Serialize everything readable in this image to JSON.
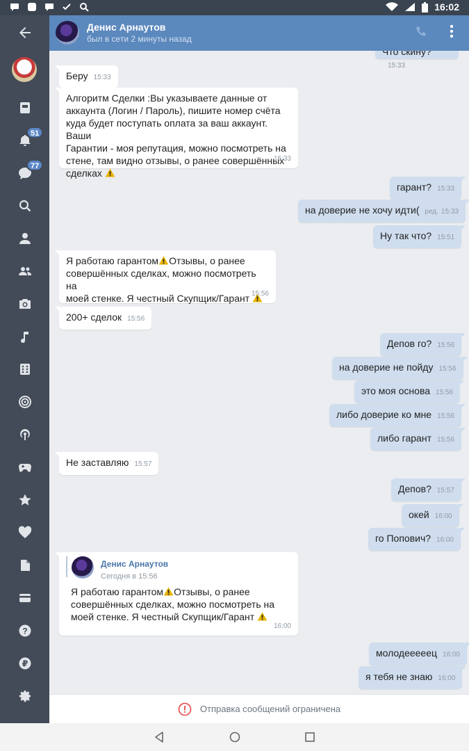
{
  "status_bar": {
    "time": "16:02"
  },
  "header": {
    "contact_name": "Денис Арнаутов",
    "contact_status": "был в сети 2 минуты назад"
  },
  "rail": {
    "notifications_badge": "51",
    "messages_badge": "77"
  },
  "messages": [
    {
      "dir": "out",
      "text": "Что скину?",
      "time": "15:33"
    },
    {
      "dir": "in",
      "text": "Беру",
      "time": "15:33"
    },
    {
      "dir": "in",
      "lines": [
        "Алгоритм Сделки :Вы указываете данные от",
        "аккаунта (Логин / Пароль), пишите номер счёта",
        "куда будет поступать оплата за ваш аккаунт. Ваши",
        "Гарантии - моя репутация, можно посмотреть на",
        "стене, там видно отзывы, о ранее совершённых",
        "сделках"
      ],
      "time": "15:33"
    },
    {
      "dir": "out",
      "text": "гарант?",
      "time": "15:33"
    },
    {
      "dir": "out",
      "text": "на доверие не хочу идти(",
      "edited": "ред.",
      "time": "15:33"
    },
    {
      "dir": "out",
      "text": "Ну так что?",
      "time": "15:51"
    },
    {
      "dir": "in",
      "lines": [
        "Я работаю гарантом",
        "Отзывы, о ранее",
        "совершённых сделках, можно посмотреть на",
        "моей стенке. Я честный Скупщик/Гарант"
      ],
      "time": "15:56"
    },
    {
      "dir": "in",
      "text": "200+ сделок",
      "time": "15:56"
    },
    {
      "dir": "out",
      "text": "Депов го?",
      "time": "15:56"
    },
    {
      "dir": "out",
      "text": "на доверие не пойду",
      "time": "15:56"
    },
    {
      "dir": "out",
      "text": "это моя основа",
      "time": "15:56"
    },
    {
      "dir": "out",
      "text": "либо доверие ко мне",
      "time": "15:56"
    },
    {
      "dir": "out",
      "text": "либо гарант",
      "time": "15:56"
    },
    {
      "dir": "in",
      "text": "Не заставляю",
      "time": "15:57"
    },
    {
      "dir": "out",
      "text": "Депов?",
      "time": "15:57"
    },
    {
      "dir": "out",
      "text": "окей",
      "time": "16:00"
    },
    {
      "dir": "out",
      "text": "го Попович?",
      "time": "16:00"
    },
    {
      "dir": "in",
      "forwarded": {
        "author": "Денис Арнаутов",
        "date": "Сегодня в 15:56",
        "lines": [
          "Я работаю гарантом",
          "Отзывы, о ранее",
          "совершённых сделках, можно посмотреть на",
          "моей стенке. Я честный Скупщик/Гарант"
        ]
      },
      "time": "16:00"
    },
    {
      "dir": "out",
      "text": "молодееееец",
      "time": "16:00"
    },
    {
      "dir": "out",
      "text": "я тебя не знаю",
      "time": "16:00"
    }
  ],
  "restricted_notice": "Отправка сообщений ограничена",
  "colors": {
    "rail_bg": "#424b57",
    "header_bg": "#5b88bd",
    "out_bubble": "#cfddee",
    "in_bubble": "#ffffff",
    "badge": "#5b87c7",
    "warning": "#e8b400",
    "alert_red": "#e64646"
  },
  "icons": [
    "back-arrow-icon",
    "news-icon",
    "bell-icon",
    "messages-icon",
    "search-icon",
    "profile-icon",
    "friends-icon",
    "camera-icon",
    "music-icon",
    "games-grid-icon",
    "target-icon",
    "podcast-icon",
    "gamepad-icon",
    "star-icon",
    "heart-icon",
    "document-icon",
    "payment-icon",
    "help-icon",
    "ruble-icon",
    "settings-icon",
    "phone-icon",
    "more-icon",
    "warning-icon",
    "restricted-icon"
  ]
}
